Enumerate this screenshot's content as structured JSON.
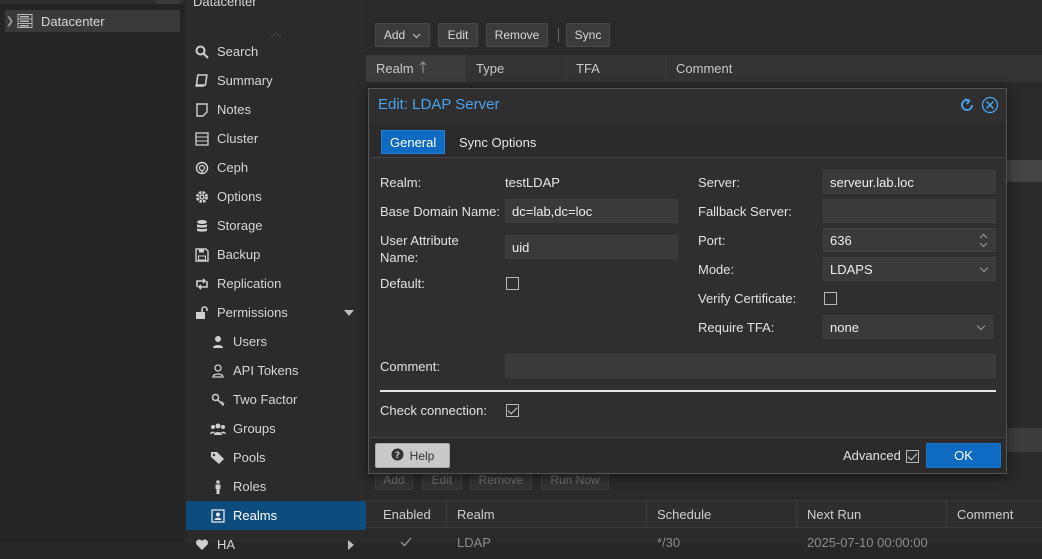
{
  "tree": {
    "root_label": "Datacenter"
  },
  "breadcrumb": "Datacenter",
  "nav": {
    "items": [
      {
        "label": "Search",
        "icon": "search-icon"
      },
      {
        "label": "Summary",
        "icon": "book-icon"
      },
      {
        "label": "Notes",
        "icon": "note-icon"
      },
      {
        "label": "Cluster",
        "icon": "server-icon"
      },
      {
        "label": "Ceph",
        "icon": "ceph-icon"
      },
      {
        "label": "Options",
        "icon": "gear-icon"
      },
      {
        "label": "Storage",
        "icon": "database-icon"
      },
      {
        "label": "Backup",
        "icon": "floppy-icon"
      },
      {
        "label": "Replication",
        "icon": "retweet-icon"
      },
      {
        "label": "Permissions",
        "icon": "unlock-icon"
      },
      {
        "label": "Users",
        "icon": "user-icon"
      },
      {
        "label": "API Tokens",
        "icon": "user-outline-icon"
      },
      {
        "label": "Two Factor",
        "icon": "key-icon"
      },
      {
        "label": "Groups",
        "icon": "users-icon"
      },
      {
        "label": "Pools",
        "icon": "tags-icon"
      },
      {
        "label": "Roles",
        "icon": "person-icon"
      },
      {
        "label": "Realms",
        "icon": "id-card-icon"
      },
      {
        "label": "HA",
        "icon": "heartbeat-icon"
      }
    ]
  },
  "toolbar": {
    "add": "Add",
    "edit": "Edit",
    "remove": "Remove",
    "sync": "Sync"
  },
  "realm_grid": {
    "columns": [
      "Realm",
      "Type",
      "TFA",
      "Comment"
    ]
  },
  "sync_toolbar": {
    "add": "Add",
    "edit": "Edit",
    "remove": "Remove",
    "run_now": "Run Now"
  },
  "sync_grid": {
    "columns": [
      "Enabled",
      "Realm",
      "Schedule",
      "Next Run",
      "Comment"
    ],
    "row": {
      "realm": "LDAP",
      "schedule": "*/30",
      "next_run": "2025-07-10 00:00:00"
    }
  },
  "dialog": {
    "title": "Edit: LDAP Server",
    "tabs": {
      "general": "General",
      "sync": "Sync Options"
    },
    "fields": {
      "realm_label": "Realm:",
      "realm_value": "testLDAP",
      "base_dn_label": "Base Domain Name:",
      "base_dn_value": "dc=lab,dc=loc",
      "user_attr_label": "User Attribute Name:",
      "user_attr_value": "uid",
      "default_label": "Default:",
      "server_label": "Server:",
      "server_value": "serveur.lab.loc",
      "fallback_label": "Fallback Server:",
      "fallback_value": "",
      "port_label": "Port:",
      "port_value": "636",
      "mode_label": "Mode:",
      "mode_value": "LDAPS",
      "verify_label": "Verify Certificate:",
      "tfa_label": "Require TFA:",
      "tfa_value": "none",
      "comment_label": "Comment:",
      "comment_value": "",
      "check_label": "Check connection:"
    },
    "footer": {
      "help": "Help",
      "advanced": "Advanced",
      "ok": "OK"
    }
  },
  "colors": {
    "accent": "#0f6ac2",
    "title": "#4aa3f0",
    "selected_nav": "#0d4d7d"
  }
}
